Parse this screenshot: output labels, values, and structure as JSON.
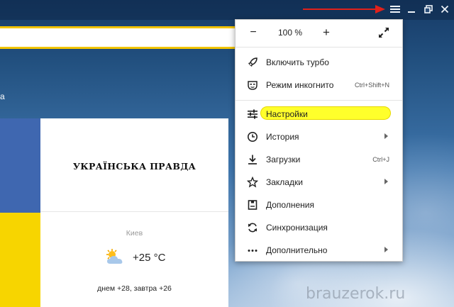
{
  "window": {
    "menu_icon": "hamburger-icon",
    "minimize_icon": "minimize-icon",
    "restore_icon": "restore-icon",
    "close_icon": "close-icon",
    "annotation_arrow_color": "#e0211b"
  },
  "page": {
    "left_fragment": "a",
    "tile_colors": {
      "blue": "#3f67b0",
      "yellow": "#f7d500"
    }
  },
  "news_card": {
    "brand": "УКРАЇНСЬКА ПРАВДА",
    "city": "Киев",
    "temperature": "+25 °C",
    "weather_icon": "partly-cloudy-icon",
    "forecast": "днем +28, завтра +26"
  },
  "menu": {
    "zoom": {
      "minus": "−",
      "value": "100 %",
      "plus": "+"
    },
    "highlight_color": "#ffff2b",
    "items": [
      {
        "label": "Включить турбо",
        "icon": "rocket-icon",
        "shortcut": ""
      },
      {
        "label": "Режим инкогнито",
        "icon": "incognito-mask-icon",
        "shortcut": "Ctrl+Shift+N"
      },
      {
        "label": "Настройки",
        "icon": "settings-sliders-icon",
        "shortcut": ""
      },
      {
        "label": "История",
        "icon": "clock-icon",
        "shortcut": ""
      },
      {
        "label": "Загрузки",
        "icon": "download-icon",
        "shortcut": "Ctrl+J"
      },
      {
        "label": "Закладки",
        "icon": "star-icon",
        "shortcut": ""
      },
      {
        "label": "Дополнения",
        "icon": "extension-icon",
        "shortcut": ""
      },
      {
        "label": "Синхронизация",
        "icon": "sync-icon",
        "shortcut": ""
      },
      {
        "label": "Дополнительно",
        "icon": "more-dots-icon",
        "shortcut": ""
      }
    ]
  },
  "watermark": "brauzerok.ru"
}
